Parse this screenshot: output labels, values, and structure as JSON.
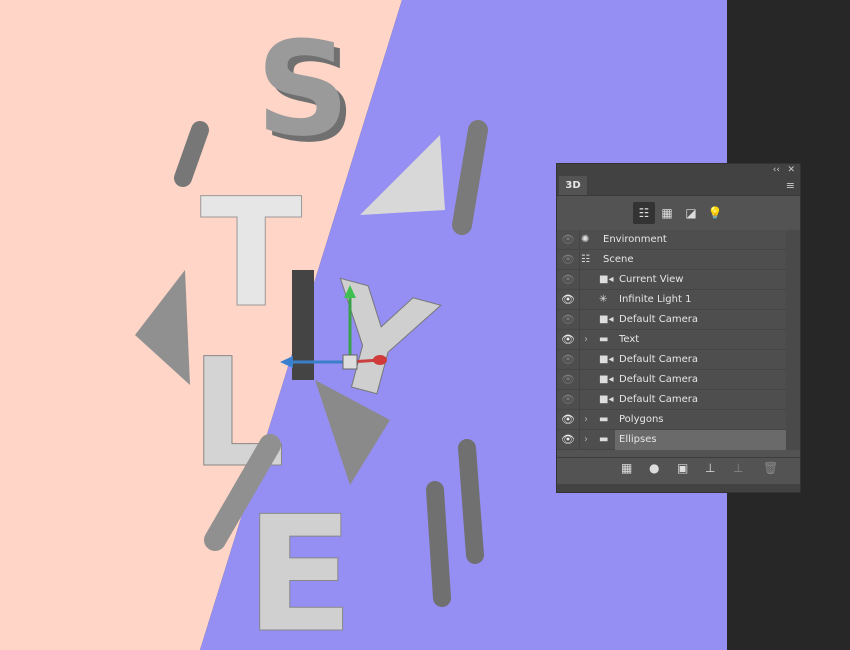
{
  "canvas": {
    "bg_left": "#fed5c6",
    "bg_right": "#958ff4",
    "bg_dark": "#272727",
    "letters": [
      "S",
      "T",
      "Y",
      "L",
      "E"
    ]
  },
  "panel": {
    "collapse": "‹‹",
    "close": "✕",
    "tab": "3D",
    "menu_icon": "≡",
    "filters": [
      "scene-icon",
      "mesh-icon",
      "material-icon",
      "light-icon"
    ],
    "items": [
      {
        "label": "Environment",
        "icon": "environment-icon",
        "visible": false,
        "indent": 0
      },
      {
        "label": "Scene",
        "icon": "scene-icon",
        "visible": false,
        "indent": 0
      },
      {
        "label": "Current View",
        "icon": "camera-icon",
        "visible": false,
        "indent": 1
      },
      {
        "label": "Infinite Light 1",
        "icon": "light-icon",
        "visible": true,
        "indent": 1
      },
      {
        "label": "Default Camera",
        "icon": "camera-icon",
        "visible": false,
        "indent": 1
      },
      {
        "label": "Text",
        "icon": "folder-icon",
        "visible": true,
        "indent": 1,
        "expandable": true
      },
      {
        "label": "Default Camera",
        "icon": "camera-icon",
        "visible": false,
        "indent": 1
      },
      {
        "label": "Default Camera",
        "icon": "camera-icon",
        "visible": false,
        "indent": 1
      },
      {
        "label": "Default Camera",
        "icon": "camera-icon",
        "visible": false,
        "indent": 1
      },
      {
        "label": "Polygons",
        "icon": "folder-icon",
        "visible": true,
        "indent": 1,
        "expandable": true
      },
      {
        "label": "Ellipses",
        "icon": "folder-icon",
        "visible": true,
        "indent": 1,
        "expandable": true,
        "selected": true
      }
    ]
  }
}
